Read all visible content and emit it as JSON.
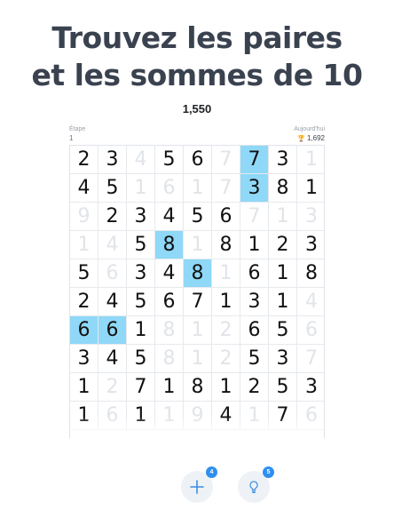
{
  "headline": {
    "line1": "Trouvez les paires",
    "line2": "et les sommes de 10"
  },
  "score": "1,550",
  "stage": {
    "label": "Étape",
    "value": "1"
  },
  "today": {
    "label": "Aujourd'hui",
    "value": "1,692",
    "icon": "trophy-icon"
  },
  "grid": {
    "columns": 9,
    "rows": [
      [
        [
          "2",
          0,
          0
        ],
        [
          "3",
          0,
          0
        ],
        [
          "4",
          1,
          0
        ],
        [
          "5",
          0,
          0
        ],
        [
          "6",
          0,
          0
        ],
        [
          "7",
          1,
          0
        ],
        [
          "7",
          0,
          1
        ],
        [
          "3",
          0,
          0
        ],
        [
          "1",
          1,
          0
        ]
      ],
      [
        [
          "4",
          0,
          0
        ],
        [
          "5",
          0,
          0
        ],
        [
          "1",
          1,
          0
        ],
        [
          "6",
          1,
          0
        ],
        [
          "1",
          1,
          0
        ],
        [
          "7",
          1,
          0
        ],
        [
          "3",
          0,
          1
        ],
        [
          "8",
          0,
          0
        ],
        [
          "1",
          0,
          0
        ]
      ],
      [
        [
          "9",
          1,
          0
        ],
        [
          "2",
          0,
          0
        ],
        [
          "3",
          0,
          0
        ],
        [
          "4",
          0,
          0
        ],
        [
          "5",
          0,
          0
        ],
        [
          "6",
          0,
          0
        ],
        [
          "7",
          1,
          0
        ],
        [
          "1",
          1,
          0
        ],
        [
          "3",
          1,
          0
        ]
      ],
      [
        [
          "1",
          1,
          0
        ],
        [
          "4",
          1,
          0
        ],
        [
          "5",
          0,
          0
        ],
        [
          "8",
          0,
          1
        ],
        [
          "1",
          1,
          0
        ],
        [
          "8",
          0,
          0
        ],
        [
          "1",
          0,
          0
        ],
        [
          "2",
          0,
          0
        ],
        [
          "3",
          0,
          0
        ]
      ],
      [
        [
          "5",
          0,
          0
        ],
        [
          "6",
          1,
          0
        ],
        [
          "3",
          0,
          0
        ],
        [
          "4",
          0,
          0
        ],
        [
          "8",
          0,
          1
        ],
        [
          "1",
          1,
          0
        ],
        [
          "6",
          0,
          0
        ],
        [
          "1",
          0,
          0
        ],
        [
          "8",
          0,
          0
        ]
      ],
      [
        [
          "2",
          0,
          0
        ],
        [
          "4",
          0,
          0
        ],
        [
          "5",
          0,
          0
        ],
        [
          "6",
          0,
          0
        ],
        [
          "7",
          0,
          0
        ],
        [
          "1",
          0,
          0
        ],
        [
          "3",
          0,
          0
        ],
        [
          "1",
          0,
          0
        ],
        [
          "4",
          1,
          0
        ]
      ],
      [
        [
          "6",
          0,
          1
        ],
        [
          "6",
          0,
          1
        ],
        [
          "1",
          0,
          0
        ],
        [
          "8",
          1,
          0
        ],
        [
          "1",
          1,
          0
        ],
        [
          "2",
          1,
          0
        ],
        [
          "6",
          0,
          0
        ],
        [
          "5",
          0,
          0
        ],
        [
          "6",
          1,
          0
        ]
      ],
      [
        [
          "3",
          0,
          0
        ],
        [
          "4",
          0,
          0
        ],
        [
          "5",
          0,
          0
        ],
        [
          "8",
          1,
          0
        ],
        [
          "1",
          1,
          0
        ],
        [
          "2",
          1,
          0
        ],
        [
          "5",
          0,
          0
        ],
        [
          "3",
          0,
          0
        ],
        [
          "7",
          1,
          0
        ]
      ],
      [
        [
          "1",
          0,
          0
        ],
        [
          "2",
          1,
          0
        ],
        [
          "7",
          0,
          0
        ],
        [
          "1",
          0,
          0
        ],
        [
          "8",
          0,
          0
        ],
        [
          "1",
          0,
          0
        ],
        [
          "2",
          0,
          0
        ],
        [
          "5",
          0,
          0
        ],
        [
          "3",
          0,
          0
        ]
      ],
      [
        [
          "1",
          0,
          0
        ],
        [
          "6",
          1,
          0
        ],
        [
          "1",
          0,
          0
        ],
        [
          "1",
          1,
          0
        ],
        [
          "9",
          1,
          0
        ],
        [
          "4",
          0,
          0
        ],
        [
          "1",
          1,
          0
        ],
        [
          "7",
          0,
          0
        ],
        [
          "6",
          1,
          0
        ]
      ]
    ]
  },
  "buttons": {
    "add": {
      "icon": "plus-icon",
      "glyph": "+",
      "badge": "4"
    },
    "hint": {
      "icon": "lightbulb-icon",
      "badge": "5"
    }
  },
  "colors": {
    "selected": "#8fd8f7",
    "cleared": "#e1e4e8",
    "badge": "#2f8ff0",
    "headline": "#3a4250"
  }
}
